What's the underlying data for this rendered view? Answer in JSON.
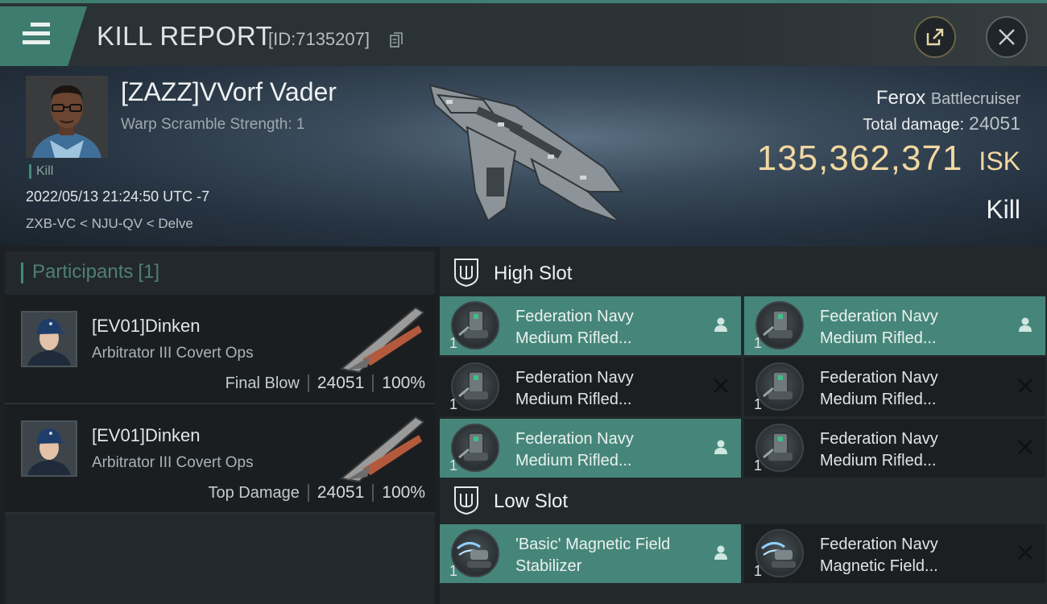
{
  "header": {
    "title": "KILL REPORT",
    "report_id": "[ID:7135207]"
  },
  "victim": {
    "name": "[ZAZZ]VVorf Vader",
    "warp_scramble": "Warp Scramble Strength: 1",
    "tag": "Kill",
    "datetime": "2022/05/13 21:24:50 UTC -7",
    "location": "ZXB-VC < NJU-QV < Delve",
    "ship": "Ferox",
    "ship_class": "Battlecruiser",
    "total_damage_label": "Total damage:",
    "total_damage": "24051",
    "isk_value": "135,362,371",
    "isk_unit": "ISK",
    "result": "Kill"
  },
  "participants": {
    "title": "Participants",
    "count": "[1]",
    "rows": [
      {
        "name": "[EV01]Dinken",
        "ship": "Arbitrator III Covert Ops",
        "role": "Final Blow",
        "damage": "24051",
        "percent": "100%"
      },
      {
        "name": "[EV01]Dinken",
        "ship": "Arbitrator III Covert Ops",
        "role": "Top Damage",
        "damage": "24051",
        "percent": "100%"
      }
    ]
  },
  "slots": {
    "high": {
      "title": "High Slot",
      "modules": [
        {
          "line1": "Federation Navy",
          "line2": "Medium Rifled...",
          "qty": "1",
          "status": "dropped"
        },
        {
          "line1": "Federation Navy",
          "line2": "Medium Rifled...",
          "qty": "1",
          "status": "dropped"
        },
        {
          "line1": "Federation Navy",
          "line2": "Medium Rifled...",
          "qty": "1",
          "status": "destroyed"
        },
        {
          "line1": "Federation Navy",
          "line2": "Medium Rifled...",
          "qty": "1",
          "status": "destroyed"
        },
        {
          "line1": "Federation Navy",
          "line2": "Medium Rifled...",
          "qty": "1",
          "status": "dropped"
        },
        {
          "line1": "Federation Navy",
          "line2": "Medium Rifled...",
          "qty": "1",
          "status": "destroyed"
        }
      ]
    },
    "low": {
      "title": "Low Slot",
      "modules": [
        {
          "line1": "'Basic' Magnetic Field",
          "line2": "Stabilizer",
          "qty": "1",
          "status": "dropped"
        },
        {
          "line1": "Federation Navy",
          "line2": "Magnetic Field...",
          "qty": "1",
          "status": "destroyed"
        }
      ]
    }
  },
  "colors": {
    "accent_teal": "#3f7c70",
    "isk_gold": "#f1d7a1",
    "dropped_bg": "#46867a"
  }
}
